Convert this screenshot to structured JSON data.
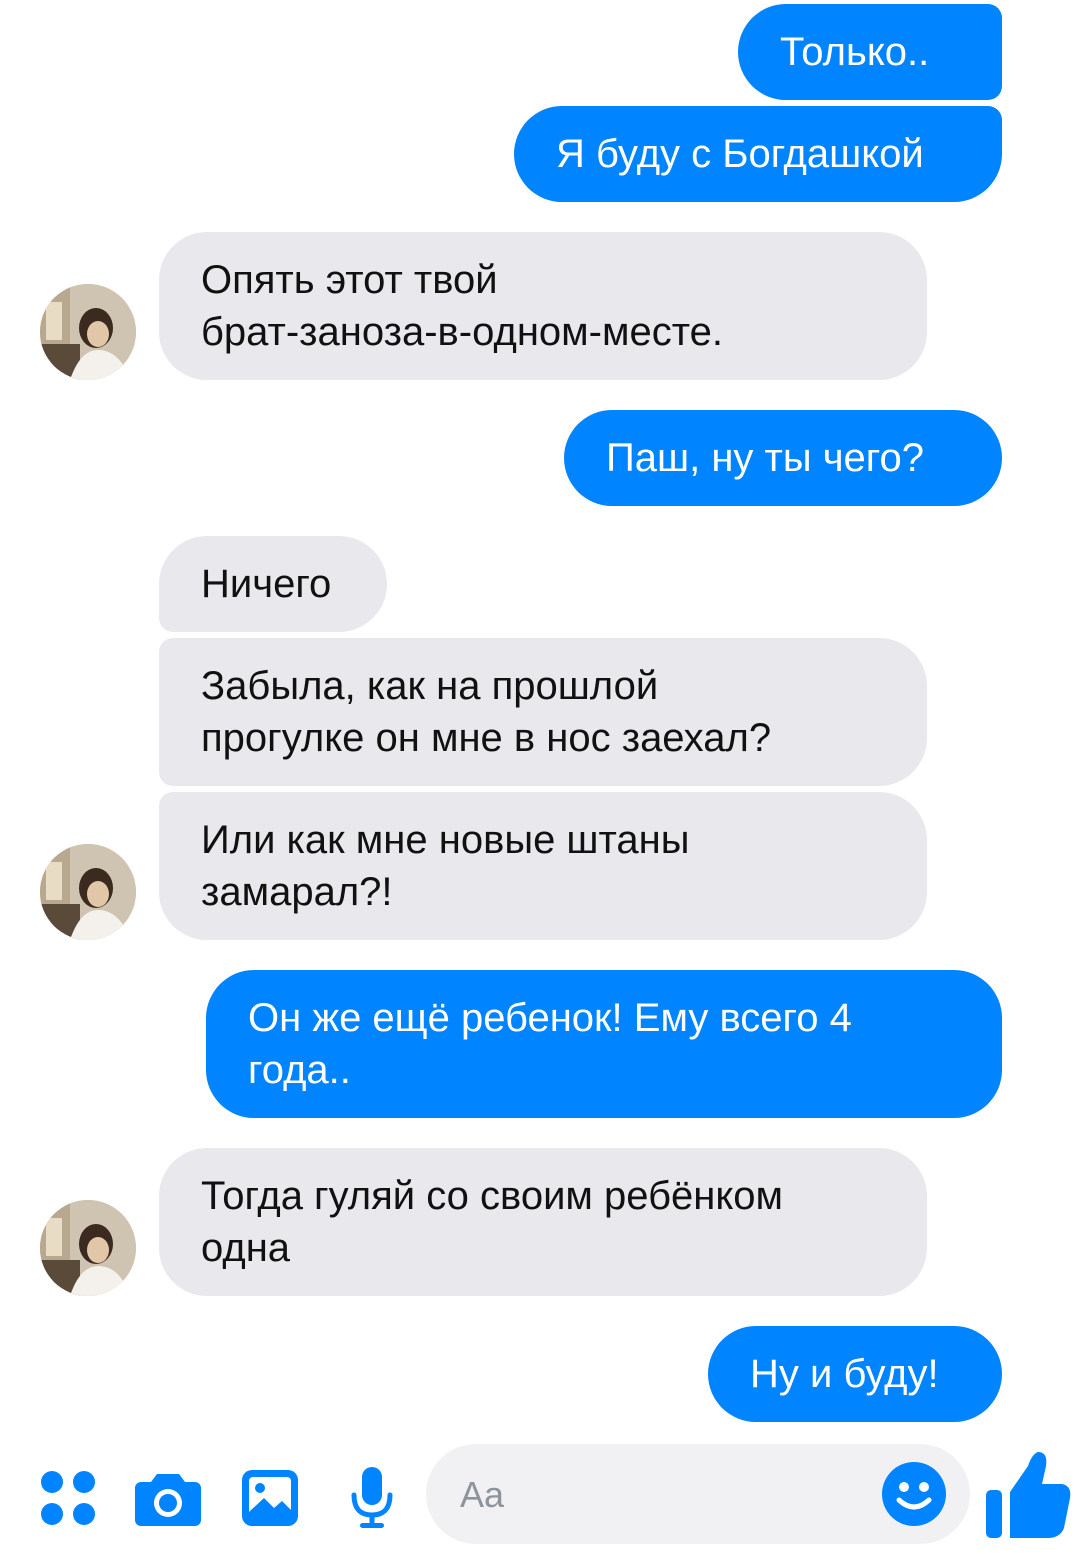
{
  "colors": {
    "accent": "#0084ff",
    "incoming_bubble": "#e9e8ed"
  },
  "messages": [
    {
      "side": "out",
      "text": "Только.."
    },
    {
      "side": "out",
      "text": "Я буду с Богдашкой"
    },
    {
      "side": "in",
      "text": "Опять этот твой\nбрат-заноза-в-одном-месте."
    },
    {
      "side": "out",
      "text": "Паш, ну ты чего?"
    },
    {
      "side": "in",
      "text": "Ничего"
    },
    {
      "side": "in",
      "text": "Забыла, как на прошлой\nпрогулке он мне в нос заехал?"
    },
    {
      "side": "in",
      "text": "Или как мне новые штаны\nзамарал?!"
    },
    {
      "side": "out",
      "text": "Он же ещё ребенок! Ему всего 4\nгода.."
    },
    {
      "side": "in",
      "text": "Тогда гуляй со своим ребёнком\nодна"
    },
    {
      "side": "out",
      "text": "Ну и буду!"
    }
  ],
  "composer": {
    "placeholder": "Aa",
    "icons": [
      "apps-icon",
      "camera-icon",
      "image-icon",
      "microphone-icon",
      "emoji-icon",
      "thumbs-up-icon"
    ]
  }
}
